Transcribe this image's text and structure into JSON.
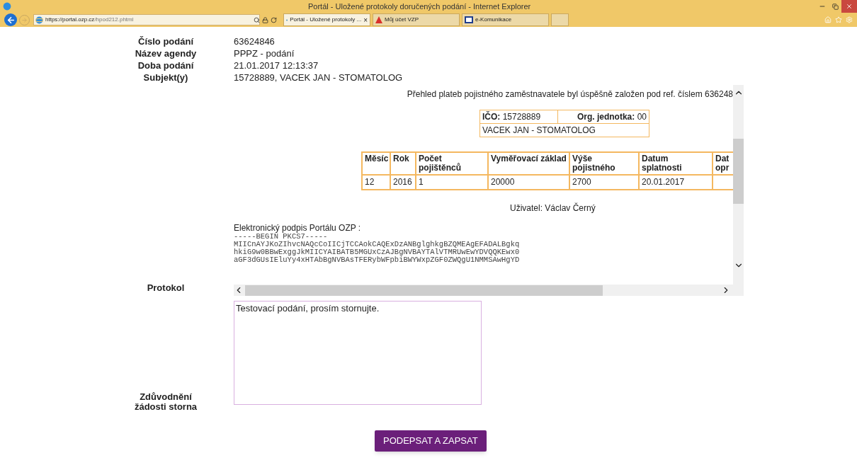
{
  "window": {
    "title": "Portál - Uložené protokoly doručených podání - Internet Explorer"
  },
  "address_bar": {
    "url_host": "https://portal.ozp.cz",
    "url_path": "/hpod212.phtml"
  },
  "tabs": [
    {
      "label": "Portál - Uložené protokoly ...",
      "selected": true,
      "close": "×"
    },
    {
      "label": "Můj účet VZP",
      "selected": false
    },
    {
      "label": "e-Komunikace",
      "selected": false
    }
  ],
  "details": [
    {
      "label": "Číslo podání",
      "value": "63624846"
    },
    {
      "label": "Název agendy",
      "value": "PPPZ - podání"
    },
    {
      "label": "Doba podání",
      "value": "21.01.2017 12:13:37"
    },
    {
      "label": "Subjekt(y)",
      "value": "15728889, VACEK JAN - STOMATOLOG"
    }
  ],
  "protocol": {
    "label": "Protokol",
    "message": "Přehled plateb pojistného zaměstnavatele byl úspěšně založen pod ref. číslem 636248",
    "employer": {
      "ico_label": "IČO:",
      "ico": "15728889",
      "unit_label": "Org. jednotka:",
      "unit": "00",
      "name": "VACEK JAN - STOMATOLOG"
    },
    "table": {
      "columns": [
        "Měsíc",
        "Rok",
        "Počet pojištěnců",
        "Vyměřovací základ",
        "Výše pojistného",
        "Datum splatnosti",
        "Dat opr"
      ],
      "rows": [
        [
          "12",
          "2016",
          "1",
          "20000",
          "2700",
          "20.01.2017",
          ""
        ]
      ]
    },
    "user": "Uživatel: Václav Černý",
    "signature_label": "Elektronický podpis Portálu OZP :",
    "signature_lines": [
      "-----BEGIN PKCS7-----",
      "MIICnAYJKoZIhvcNAQcCoIICjTCCAokCAQExDzANBglghkgBZQMEAgEFADALBgkq",
      "hkiG9w0BBwExggJkMIICYAIBATB5MGUxCzAJBgNVBAYTAlVTMRUwEwYDVQQKEwx0",
      "aGF3dGUsIEluYy4xHTAbBgNVBAsTFERybWFpbiBWYWxpZGF0ZWQgU1NMMSAwHgYD"
    ]
  },
  "reason": {
    "label": "Zdůvodnění žádosti storna",
    "value": "Testovací podání, prosím stornujte."
  },
  "submit": {
    "label": "PODEPSAT A ZAPSAT"
  }
}
